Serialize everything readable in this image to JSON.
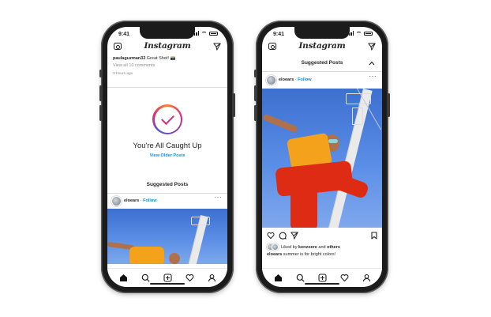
{
  "status": {
    "time": "9:41"
  },
  "app": {
    "logo_text": "Instagram"
  },
  "left_phone": {
    "caption": {
      "username": "paulaguzman32",
      "text": "Great Shot! 📸"
    },
    "view_comments": "View all 10 comments",
    "timestamp": "3 hours ago",
    "caught_up": {
      "title": "You're All Caught Up",
      "link": "View Older Posts"
    },
    "suggested_header": "Suggested Posts",
    "post": {
      "username": "eloears",
      "separator": " · ",
      "follow": "Follow"
    }
  },
  "right_phone": {
    "suggested_header": "Suggested Posts",
    "post": {
      "username": "eloears",
      "separator": " · ",
      "follow": "Follow"
    },
    "likes": {
      "prefix": "Liked by ",
      "user": "kenzoere",
      "and": " and ",
      "others": "others"
    },
    "caption": {
      "username": "eloears",
      "text": "summer is for bright colors!"
    }
  },
  "tabs": [
    "home-icon",
    "search-icon",
    "add-post-icon",
    "activity-heart-icon",
    "profile-icon"
  ],
  "colors": {
    "link_blue": "#0095f6",
    "sky_blue": "#4a7fdb",
    "orange": "#f4a21c",
    "red": "#dd2b14"
  }
}
